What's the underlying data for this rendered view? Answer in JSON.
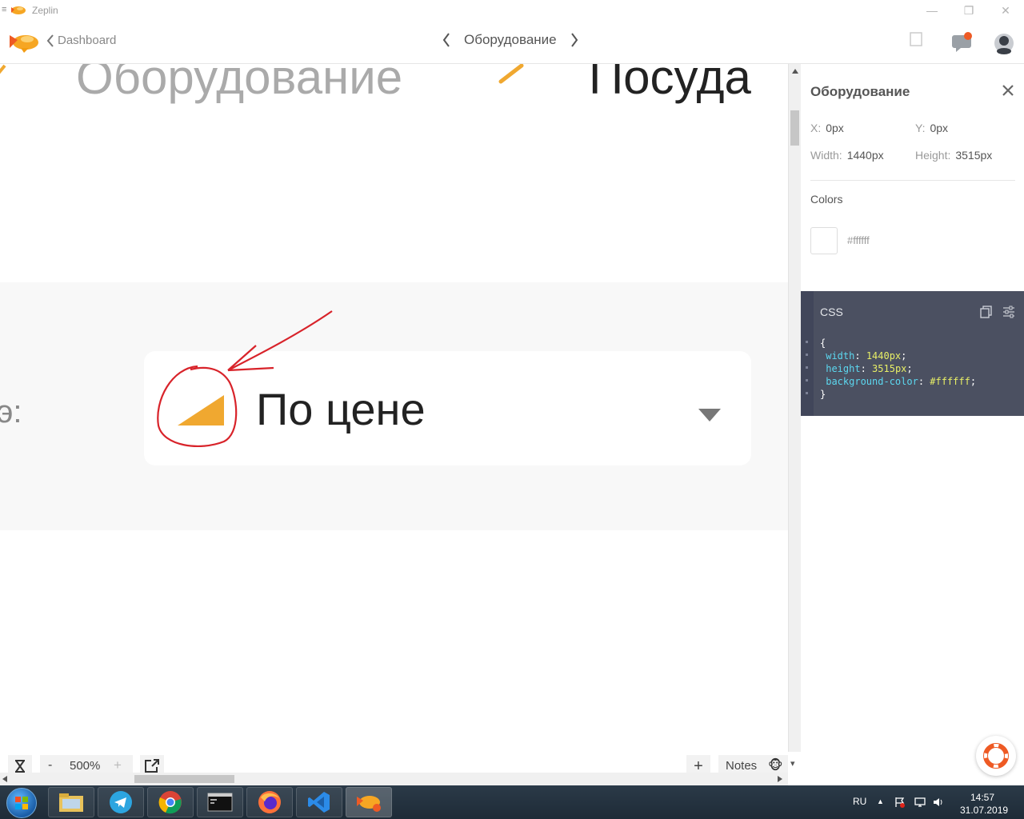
{
  "window": {
    "title": "Zeplin",
    "controls": {
      "minimize": "—",
      "restore": "❐",
      "close": "✕"
    }
  },
  "nav": {
    "back_label": "Dashboard",
    "screen_title": "Оборудование"
  },
  "canvas": {
    "heading_left": "Оборудование",
    "heading_right": "Посуда",
    "dropdown_text": "По цене",
    "edge_text": "э:",
    "sort_icon_color": "#f0a830",
    "annotation_color": "#d8232a"
  },
  "toolbar": {
    "zoom_out": "-",
    "zoom_level": "500%",
    "zoom_in": "+",
    "add": "+",
    "notes_label": "Notes",
    "notes_emoji": "🐵",
    "notes_caret": "▾"
  },
  "sidebar": {
    "title": "Оборудование",
    "x_label": "X:",
    "x_value": "0px",
    "y_label": "Y:",
    "y_value": "0px",
    "width_label": "Width:",
    "width_value": "1440px",
    "height_label": "Height:",
    "height_value": "3515px",
    "colors_label": "Colors",
    "color_value": "#ffffff",
    "css_label": "CSS",
    "css": {
      "open": "{",
      "close": "}",
      "rules": [
        {
          "prop": "width",
          "value": "1440px"
        },
        {
          "prop": "height",
          "value": "3515px"
        },
        {
          "prop": "background-color",
          "value": "#ffffff"
        }
      ]
    }
  },
  "taskbar": {
    "lang": "RU",
    "time": "14:57",
    "date": "31.07.2019",
    "tray_arrow": "▲"
  }
}
